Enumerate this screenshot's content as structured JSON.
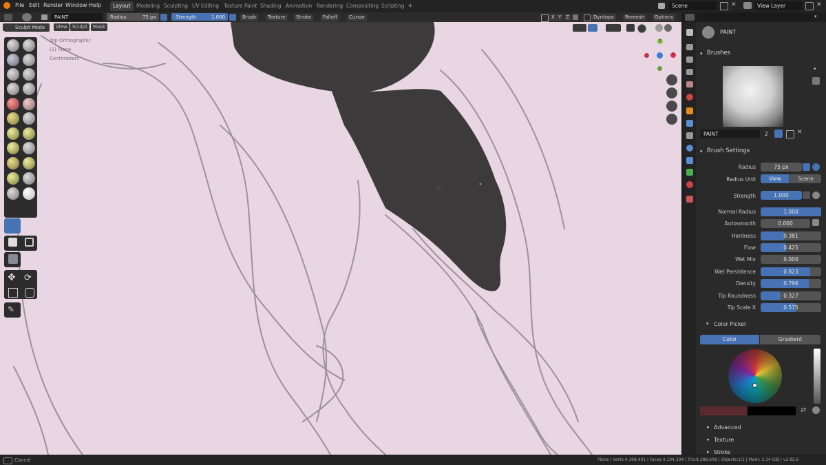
{
  "menu": [
    "File",
    "Edit",
    "Render",
    "Window",
    "Help"
  ],
  "workspaces": [
    "Layout",
    "Modeling",
    "Sculpting",
    "UV Editing",
    "Texture Paint",
    "Shading",
    "Animation",
    "Rendering",
    "Compositing",
    "Scripting",
    "+"
  ],
  "scene": "Scene",
  "view_layer": "View Layer",
  "tool_header": {
    "brush_name": "PAINT",
    "radius_label": "Radius",
    "radius_value": "75 px",
    "strength_label": "Strength",
    "strength_value": "1.000",
    "menus": [
      "Brush",
      "Texture",
      "Stroke",
      "Falloff",
      "Cursor"
    ],
    "axes": [
      "X",
      "Y",
      "Z"
    ],
    "dyntopo": "Dyntopo",
    "remesh": "Remesh",
    "options": "Options"
  },
  "mode_header": {
    "mode": "Sculpt Mode",
    "items": [
      "View",
      "Sculpt",
      "Mask"
    ]
  },
  "viewport_info": [
    "Top Orthographic",
    "(1) Plane",
    "Centimeters"
  ],
  "gizmo": {
    "z": "Z",
    "y": "Y",
    "x": "X"
  },
  "panel": {
    "brush_label": "PAINT",
    "brushes_title": "Brushes",
    "brush_field": "PAINT",
    "brush_users": "2",
    "brush_settings_title": "Brush Settings",
    "radius": {
      "label": "Radius",
      "value": "75 px"
    },
    "radius_unit": {
      "label": "Radius Unit",
      "view": "View",
      "scene": "Scene"
    },
    "strength": {
      "label": "Strength",
      "value": "1.000"
    },
    "props": [
      {
        "label": "Normal Radius",
        "value": "1.000",
        "fill": 1.0
      },
      {
        "label": "Autosmooth",
        "value": "0.000",
        "fill": 0.0
      },
      {
        "label": "Hardness",
        "value": "0.381",
        "fill": 0.381
      },
      {
        "label": "Flow",
        "value": "0.425",
        "fill": 0.425
      },
      {
        "label": "Wet Mix",
        "value": "0.000",
        "fill": 0.0
      },
      {
        "label": "Wet Persistence",
        "value": "0.823",
        "fill": 0.823
      },
      {
        "label": "Density",
        "value": "0.796",
        "fill": 0.796
      },
      {
        "label": "Tip Roundness",
        "value": "0.327",
        "fill": 0.327
      },
      {
        "label": "Tip Scale X",
        "value": "0.575",
        "fill": 0.575
      }
    ],
    "color_picker_title": "Color Picker",
    "color_tab": "Color",
    "gradient_tab": "Gradient",
    "primary_color": "#5a2a2e",
    "secondary_color": "#000000",
    "collapsed": [
      "Advanced",
      "Texture",
      "Stroke"
    ]
  },
  "status": {
    "left": "Cancel",
    "right": "Plane | Verts:4,198,401 | Faces:4,194,304 | Tris:8,388,608 | Objects:1/1 | Mem: 3.34 GiB | v2.82.6"
  },
  "colors": {
    "accent": "#4772b3",
    "viewport_bg": "#e8d6e2",
    "paint": "#3d3a3c"
  }
}
